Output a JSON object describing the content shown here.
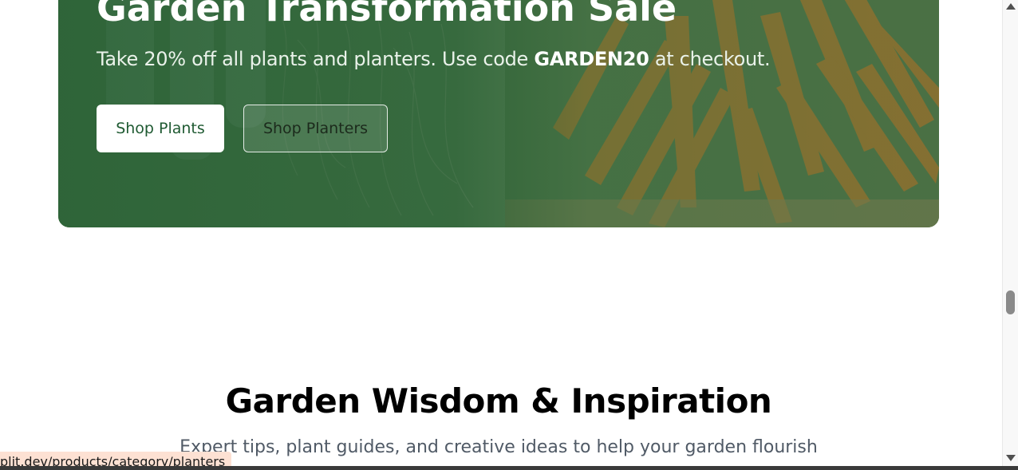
{
  "banner": {
    "title": "Garden Transformation Sale",
    "text_before": "Take 20% off all plants and planters. Use code ",
    "code": "GARDEN20",
    "text_after": " at checkout.",
    "primary_button": "Shop Plants",
    "secondary_button": "Shop Planters"
  },
  "section": {
    "title": "Garden Wisdom & Inspiration",
    "subtitle": "Expert tips, plant guides, and creative ideas to help your garden flourish"
  },
  "status_bar": {
    "url": "plit.dev/products/category/planters"
  },
  "colors": {
    "banner_green": "#225c30",
    "button_text_green": "#1f5a32"
  },
  "icons": {
    "scroll_up": "triangle-up",
    "scroll_down": "triangle-down"
  }
}
